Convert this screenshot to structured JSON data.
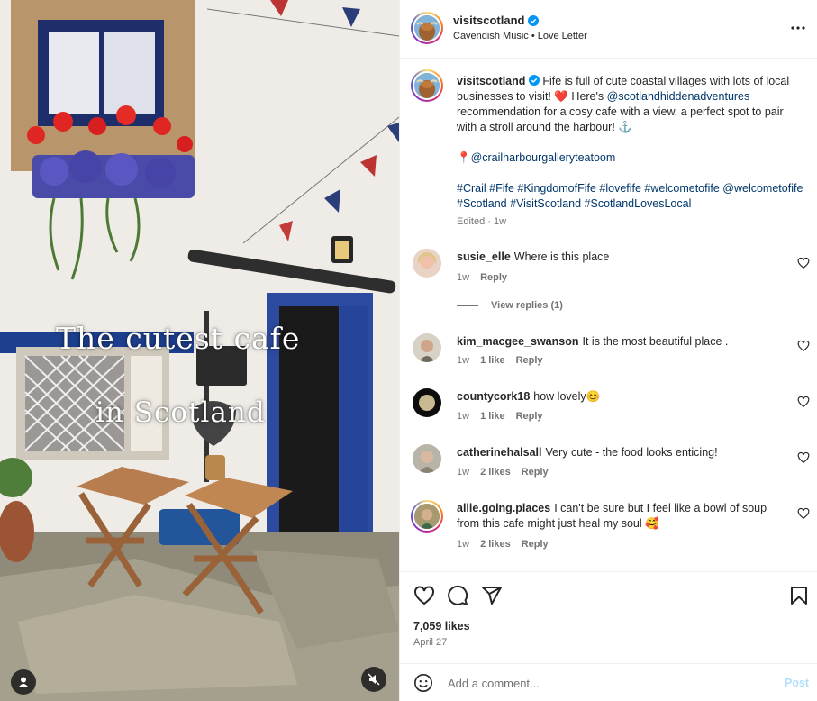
{
  "post": {
    "username": "visitscotland",
    "audio": "Cavendish Music • Love Letter",
    "video_overlay": {
      "line1": "The cutest cafe",
      "line2": "in Scotland"
    }
  },
  "caption": {
    "username": "visitscotland",
    "p1_a": "Fife is full of cute coastal villages with lots of local businesses to visit! ❤️ Here's ",
    "p1_mention": "@scotlandhiddenadventures",
    "p1_b": " recommendation for a cosy cafe with a view, a perfect spot to pair with a stroll around the harbour! ⚓",
    "location_pin": "📍",
    "location_mention": "@crailharbourgalleryteatoom",
    "hashtags": "#Crail #Fife #KingdomofFife #lovefife #welcometofife @welcometofife #Scotland #VisitScotland #ScotlandLovesLocal",
    "meta": "Edited · 1w"
  },
  "comments": [
    {
      "username": "susie_elle",
      "text": "Where is this place",
      "time": "1w",
      "likes": "",
      "reply": "Reply"
    },
    {
      "username": "kim_macgee_swanson",
      "text": "It is the most beautiful place .",
      "time": "1w",
      "likes": "1 like",
      "reply": "Reply"
    },
    {
      "username": "countycork18",
      "text": "how lovely😊",
      "time": "1w",
      "likes": "1 like",
      "reply": "Reply"
    },
    {
      "username": "catherinehalsall",
      "text": "Very cute - the food looks enticing!",
      "time": "1w",
      "likes": "2 likes",
      "reply": "Reply"
    },
    {
      "username": "allie.going.places",
      "text": "I can't be sure but I feel like a bowl of soup from this cafe might just heal my soul 🥰",
      "time": "1w",
      "likes": "2 likes",
      "reply": "Reply"
    }
  ],
  "view_replies": "View replies (1)",
  "stats": {
    "likes": "7,059 likes",
    "date": "April 27"
  },
  "add_comment": {
    "placeholder": "Add a comment...",
    "post_label": "Post"
  },
  "colors": {
    "link": "#00376b",
    "verified": "#0095f6",
    "post_disabled": "#b2dffc",
    "muted": "#737373"
  },
  "icons": [
    "more-icon",
    "verified-icon",
    "heart-icon",
    "comment-icon",
    "share-icon",
    "bookmark-icon",
    "emoji-icon",
    "user-tag-icon",
    "mute-icon"
  ]
}
